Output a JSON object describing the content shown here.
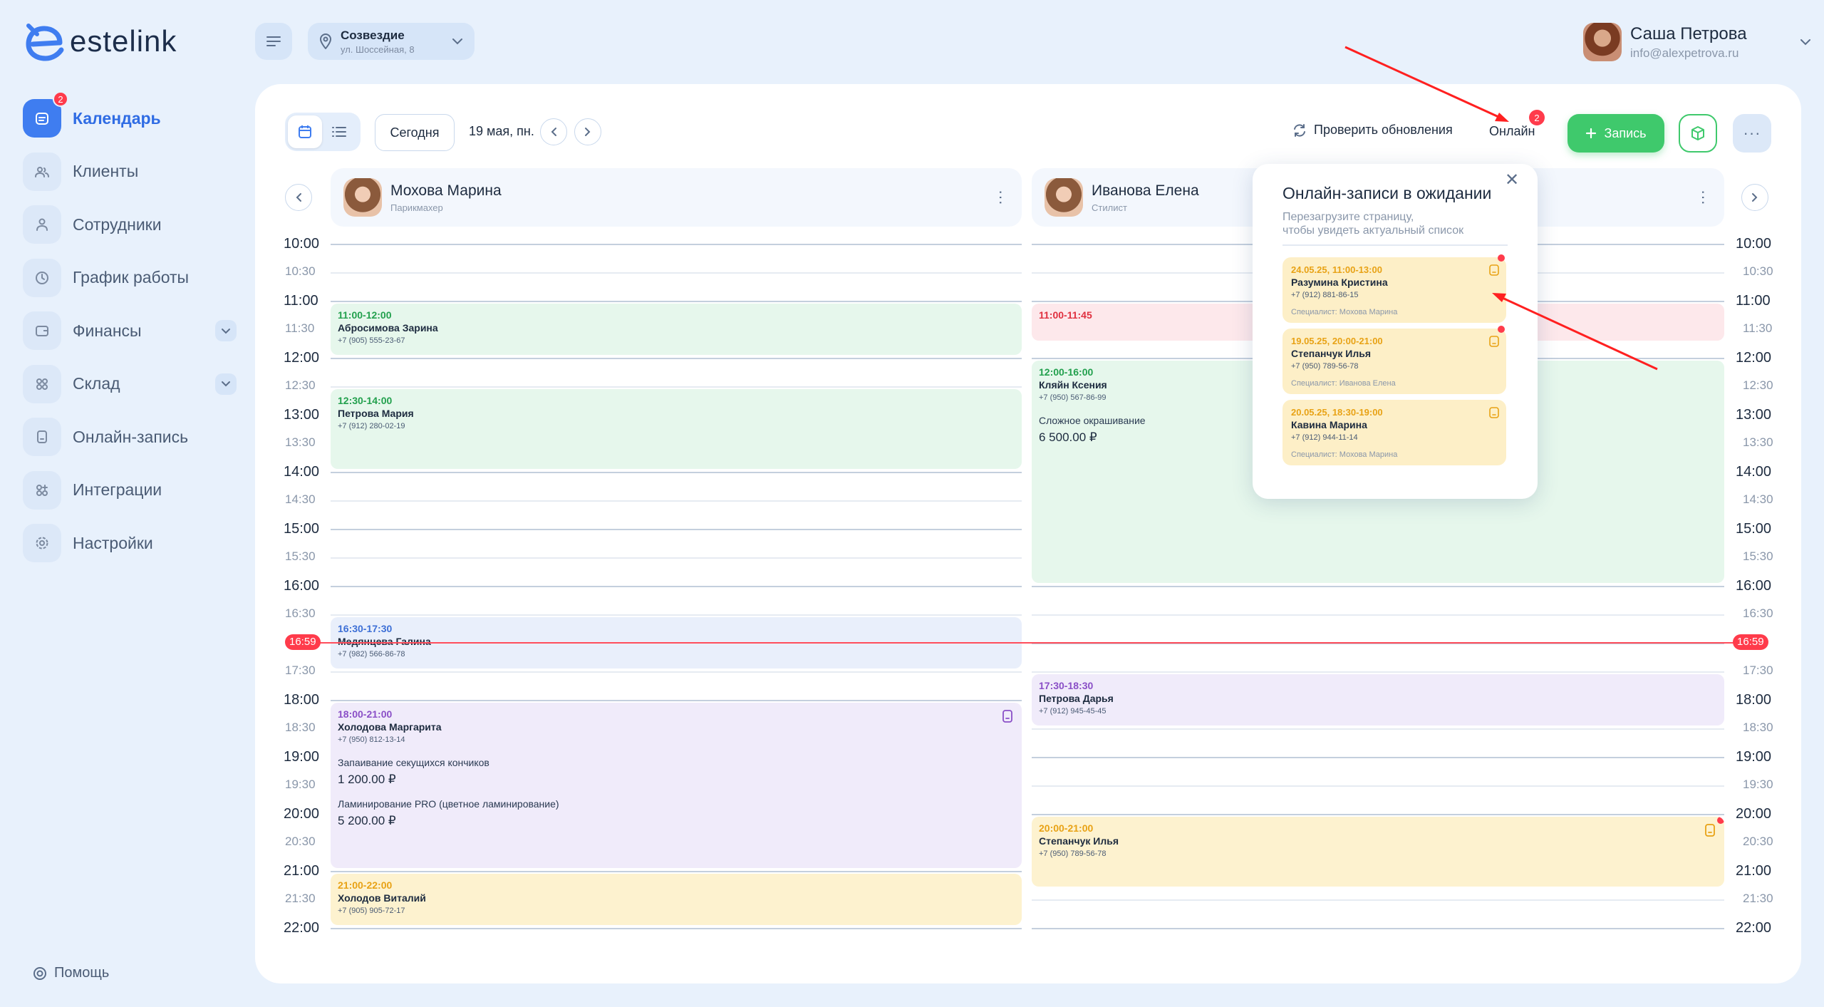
{
  "brand": {
    "name": "estelink"
  },
  "header": {
    "branch_name": "Созвездие",
    "branch_address": "ул. Шоссейная, 8",
    "user_name": "Саша Петрова",
    "user_email": "info@alexpetrova.ru"
  },
  "sidebar": {
    "items": [
      {
        "label": "Календарь",
        "icon": "calendar-icon",
        "active": true,
        "badge": "2"
      },
      {
        "label": "Клиенты",
        "icon": "clients-icon"
      },
      {
        "label": "Сотрудники",
        "icon": "staff-icon"
      },
      {
        "label": "График работы",
        "icon": "clock-icon"
      },
      {
        "label": "Финансы",
        "icon": "wallet-icon",
        "expandable": true
      },
      {
        "label": "Склад",
        "icon": "warehouse-icon",
        "expandable": true
      },
      {
        "label": "Онлайн-запись",
        "icon": "online-booking-icon"
      },
      {
        "label": "Интеграции",
        "icon": "integrations-icon"
      },
      {
        "label": "Настройки",
        "icon": "settings-icon"
      }
    ],
    "help": "Помощь"
  },
  "toolbar": {
    "today": "Сегодня",
    "date": "19 мая, пн.",
    "refresh": "Проверить обновления",
    "online": "Онлайн",
    "online_badge": "2",
    "add": "Запись",
    "more": "···"
  },
  "staff": [
    {
      "name": "Мохова Марина",
      "role": "Парикмахер"
    },
    {
      "name": "Иванова Елена",
      "role": "Стилист"
    }
  ],
  "times": [
    "10:00",
    "10:30",
    "11:00",
    "11:30",
    "12:00",
    "12:30",
    "13:00",
    "13:30",
    "14:00",
    "14:30",
    "15:00",
    "15:30",
    "16:00",
    "16:30",
    "17:00",
    "17:30",
    "18:00",
    "18:30",
    "19:00",
    "19:30",
    "20:00",
    "20:30",
    "21:00",
    "21:30",
    "22:00"
  ],
  "now": "16:59",
  "appointments": {
    "col1": [
      {
        "time": "11:00-12:00",
        "name": "Абросимова Зарина",
        "phone": "+7 (905) 555-23-67",
        "color": "green",
        "start": 11,
        "end": 12
      },
      {
        "time": "12:30-14:00",
        "name": "Петрова Мария",
        "phone": "+7 (912) 280-02-19",
        "color": "green",
        "start": 12.5,
        "end": 14
      },
      {
        "time": "16:30-17:30",
        "name": "Медянцева Галина",
        "phone": "+7 (982) 566-86-78",
        "color": "blue",
        "start": 16.5,
        "end": 17.5
      },
      {
        "time": "18:00-21:00",
        "name": "Холодова Маргарита",
        "phone": "+7 (950) 812-13-14",
        "color": "purple",
        "start": 18,
        "end": 21,
        "online": true,
        "services": [
          {
            "name": "Запаивание секущихся кончиков",
            "price": "1 200.00 ₽"
          },
          {
            "name": "Ламинирование PRO (цветное ламинирование)",
            "price": "5 200.00 ₽"
          }
        ]
      },
      {
        "time": "21:00-22:00",
        "name": "Холодов Виталий",
        "phone": "+7 (905) 905-72-17",
        "color": "yellow",
        "start": 21,
        "end": 22
      }
    ],
    "col2": [
      {
        "time": "11:00-11:45",
        "name": "",
        "phone": "",
        "color": "red",
        "start": 11,
        "end": 11.75
      },
      {
        "time": "12:00-16:00",
        "name": "Кляйн Ксения",
        "phone": "+7 (950) 567-86-99",
        "color": "green",
        "start": 12,
        "end": 16,
        "services": [
          {
            "name": "Сложное окрашивание",
            "price": "6 500.00 ₽"
          }
        ]
      },
      {
        "time": "17:30-18:30",
        "name": "Петрова Дарья",
        "phone": "+7 (912) 945-45-45",
        "color": "purple",
        "start": 17.5,
        "end": 18.5
      },
      {
        "time": "20:00-21:00",
        "name": "Степанчук Илья",
        "phone": "+7 (950) 789-56-78",
        "color": "yellow",
        "start": 20,
        "end": 21.33,
        "online": true,
        "new": true
      }
    ]
  },
  "popup": {
    "title": "Онлайн-записи в ожидании",
    "subtitle_1": "Перезагрузите страницу,",
    "subtitle_2": "чтобы увидеть актуальный список",
    "items": [
      {
        "date": "24.05.25, 11:00-13:00",
        "name": "Разумина Кристина",
        "phone": "+7 (912) 881-86-15",
        "specialist": "Специалист: Мохова Марина",
        "new": true
      },
      {
        "date": "19.05.25, 20:00-21:00",
        "name": "Степанчук Илья",
        "phone": "+7 (950) 789-56-78",
        "specialist": "Специалист: Иванова Елена",
        "new": true
      },
      {
        "date": "20.05.25, 18:30-19:00",
        "name": "Кавина Марина",
        "phone": "+7 (912) 944-11-14",
        "specialist": "Специалист: Мохова Марина",
        "new": false
      }
    ]
  },
  "colors": {
    "accent": "#3f7df0",
    "success": "#3fc96c",
    "danger": "#ff3b4b",
    "annotation": "#ff2020"
  }
}
